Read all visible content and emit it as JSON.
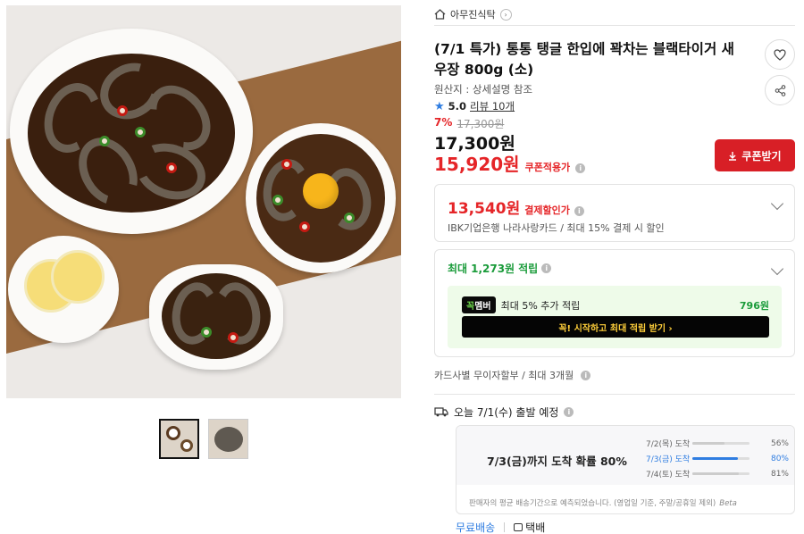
{
  "store": {
    "name": "아무진식탁",
    "home_icon": "home-icon",
    "chevron": "›"
  },
  "product": {
    "title": "(7/1 특가) 통통 탱글 한입에 꽉차는 블랙타이거 새우장 800g (소)",
    "origin": "원산지 : 상세설명 참조",
    "rating": "5.0",
    "reviews": "리뷰 10개",
    "discount_pct": "7%",
    "original_price": "17,300원",
    "price": "17,300원",
    "coupon_price": "15,920원",
    "coupon_price_label": "쿠폰적용가",
    "coupon_button": "쿠폰받기"
  },
  "payment_discount": {
    "amount": "13,540원",
    "label": "결제할인가",
    "desc": "IBK기업은행 나라사랑카드 / 최대 15% 결제 시 할인"
  },
  "points": {
    "prefix": "최대",
    "amount": "1,273원",
    "suffix": "적립",
    "member_badge_a": "꼭",
    "member_badge_b": "멤버",
    "member_text": "최대 5% 추가 적립",
    "member_points": "796원",
    "member_cta": "꼭! 시작하고 최대 적립 받기  ›"
  },
  "installment": {
    "text": "카드사별 무이자할부 / 최대 3개월"
  },
  "shipping": {
    "departure": "오늘 7/1(수) 출발 예정",
    "summary": "7/3(금)까지 도착 확률 80%",
    "rows": [
      {
        "label": "7/2(목) 도착",
        "pct": "56%",
        "value": 0.56
      },
      {
        "label": "7/3(금) 도착",
        "pct": "80%",
        "value": 0.8
      },
      {
        "label": "7/4(토) 도착",
        "pct": "81%",
        "value": 0.81
      }
    ],
    "note": "판매자의 평균 배송기간으로 예측되었습니다. (영업일 기준, 주말/공휴일 제외)",
    "beta": "Beta",
    "free": "무료배송",
    "type": "택배"
  },
  "colors": {
    "red": "#e52528",
    "green": "#1a9b3a",
    "blue": "#2f7de1"
  }
}
